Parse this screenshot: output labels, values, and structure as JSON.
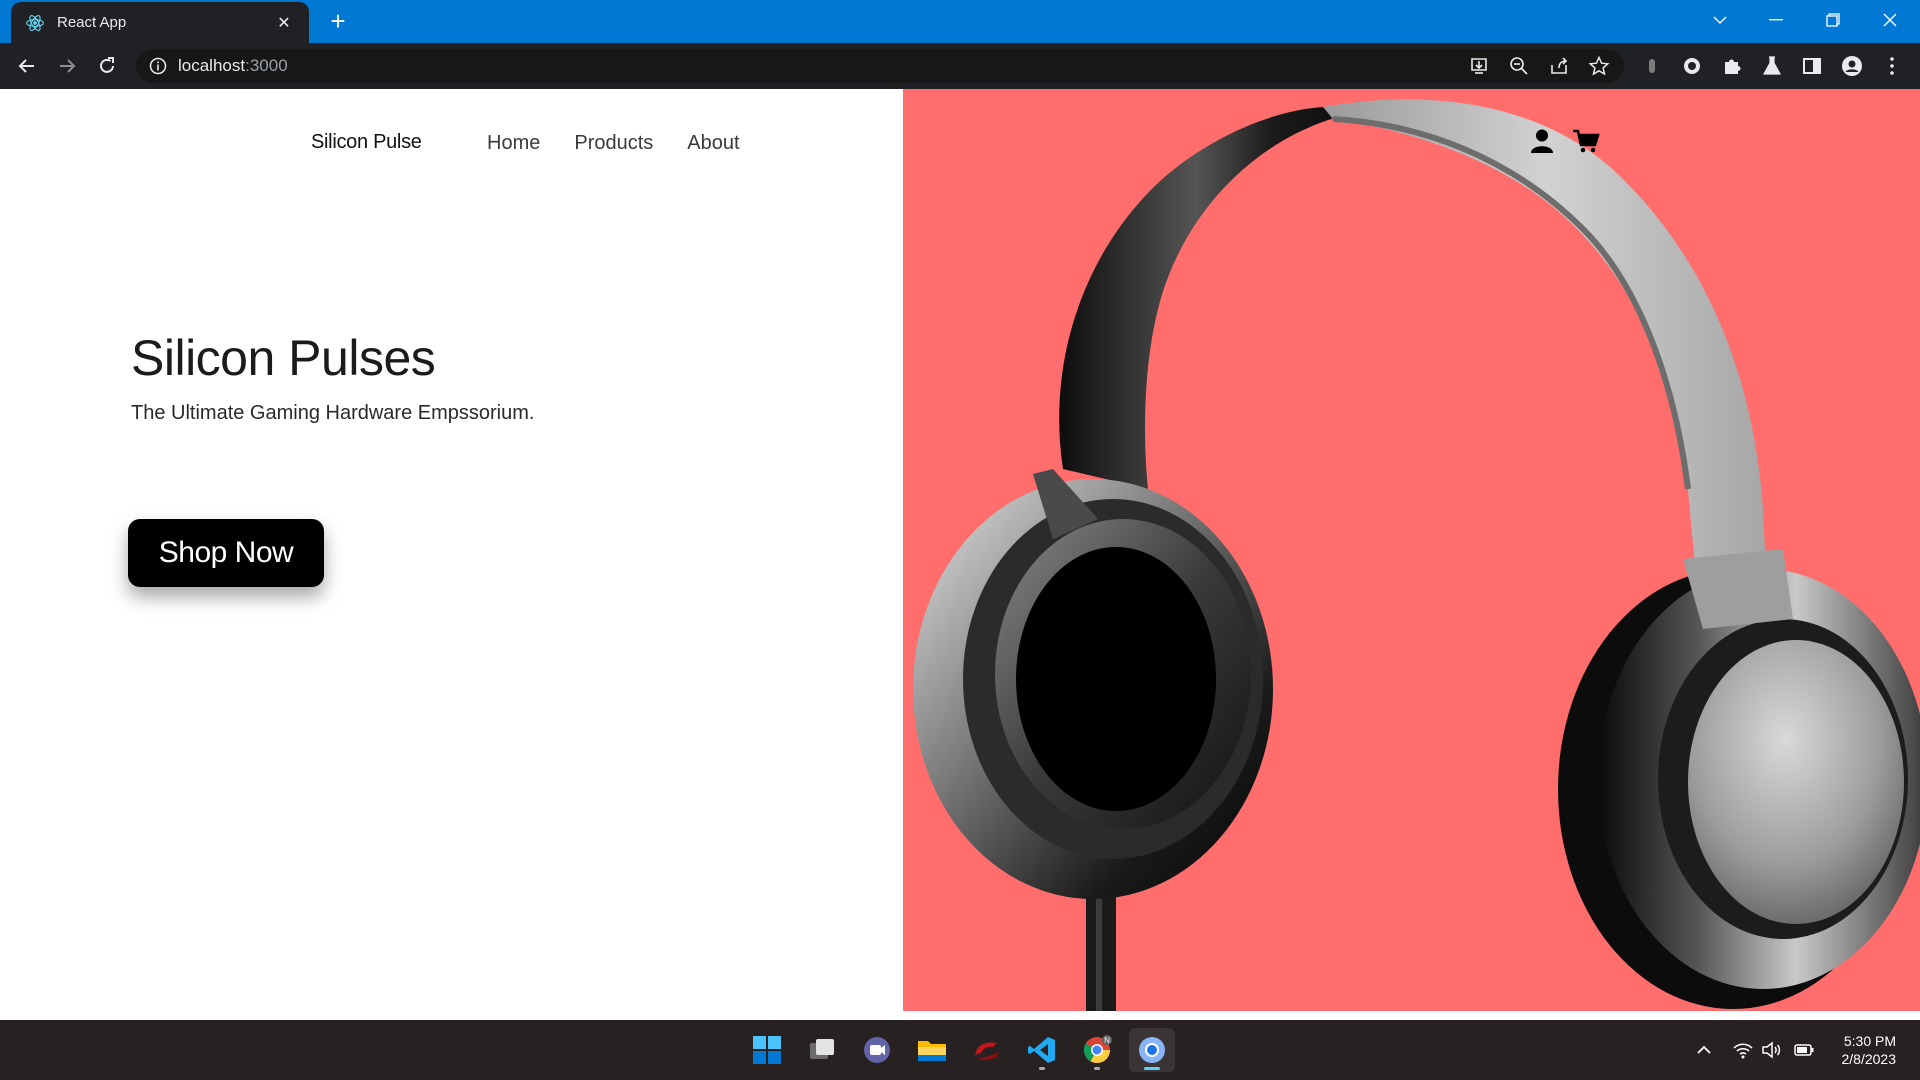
{
  "browser": {
    "tab_title": "React App",
    "url_host": "localhost",
    "url_port": ":3000"
  },
  "site": {
    "brand": "Silicon Pulse",
    "nav": [
      "Home",
      "Products",
      "About"
    ],
    "hero_title": "Silicon Pulses",
    "hero_subtitle": "The Ultimate Gaming Hardware Empssorium.",
    "cta_label": "Shop Now"
  },
  "colors": {
    "tabbar": "#0078d4",
    "chrome_dark": "#202124",
    "hero_background": "#ff6d6d",
    "cta_background": "#000000",
    "taskbar": "#272121",
    "active_indicator": "#60cdff"
  },
  "icons": {
    "page": [
      "user-icon",
      "cart-icon"
    ],
    "taskbar": [
      "windows-start-icon",
      "task-view-icon",
      "teams-chat-icon",
      "file-explorer-icon",
      "red-app-icon",
      "vscode-icon",
      "chrome-icon",
      "chrome-active-icon"
    ],
    "tray": [
      "chevron-up-icon",
      "wifi-icon",
      "volume-icon",
      "battery-icon"
    ]
  },
  "taskbar": {
    "chrome_badge": "N",
    "time": "5:30 PM",
    "date": "2/8/2023"
  }
}
